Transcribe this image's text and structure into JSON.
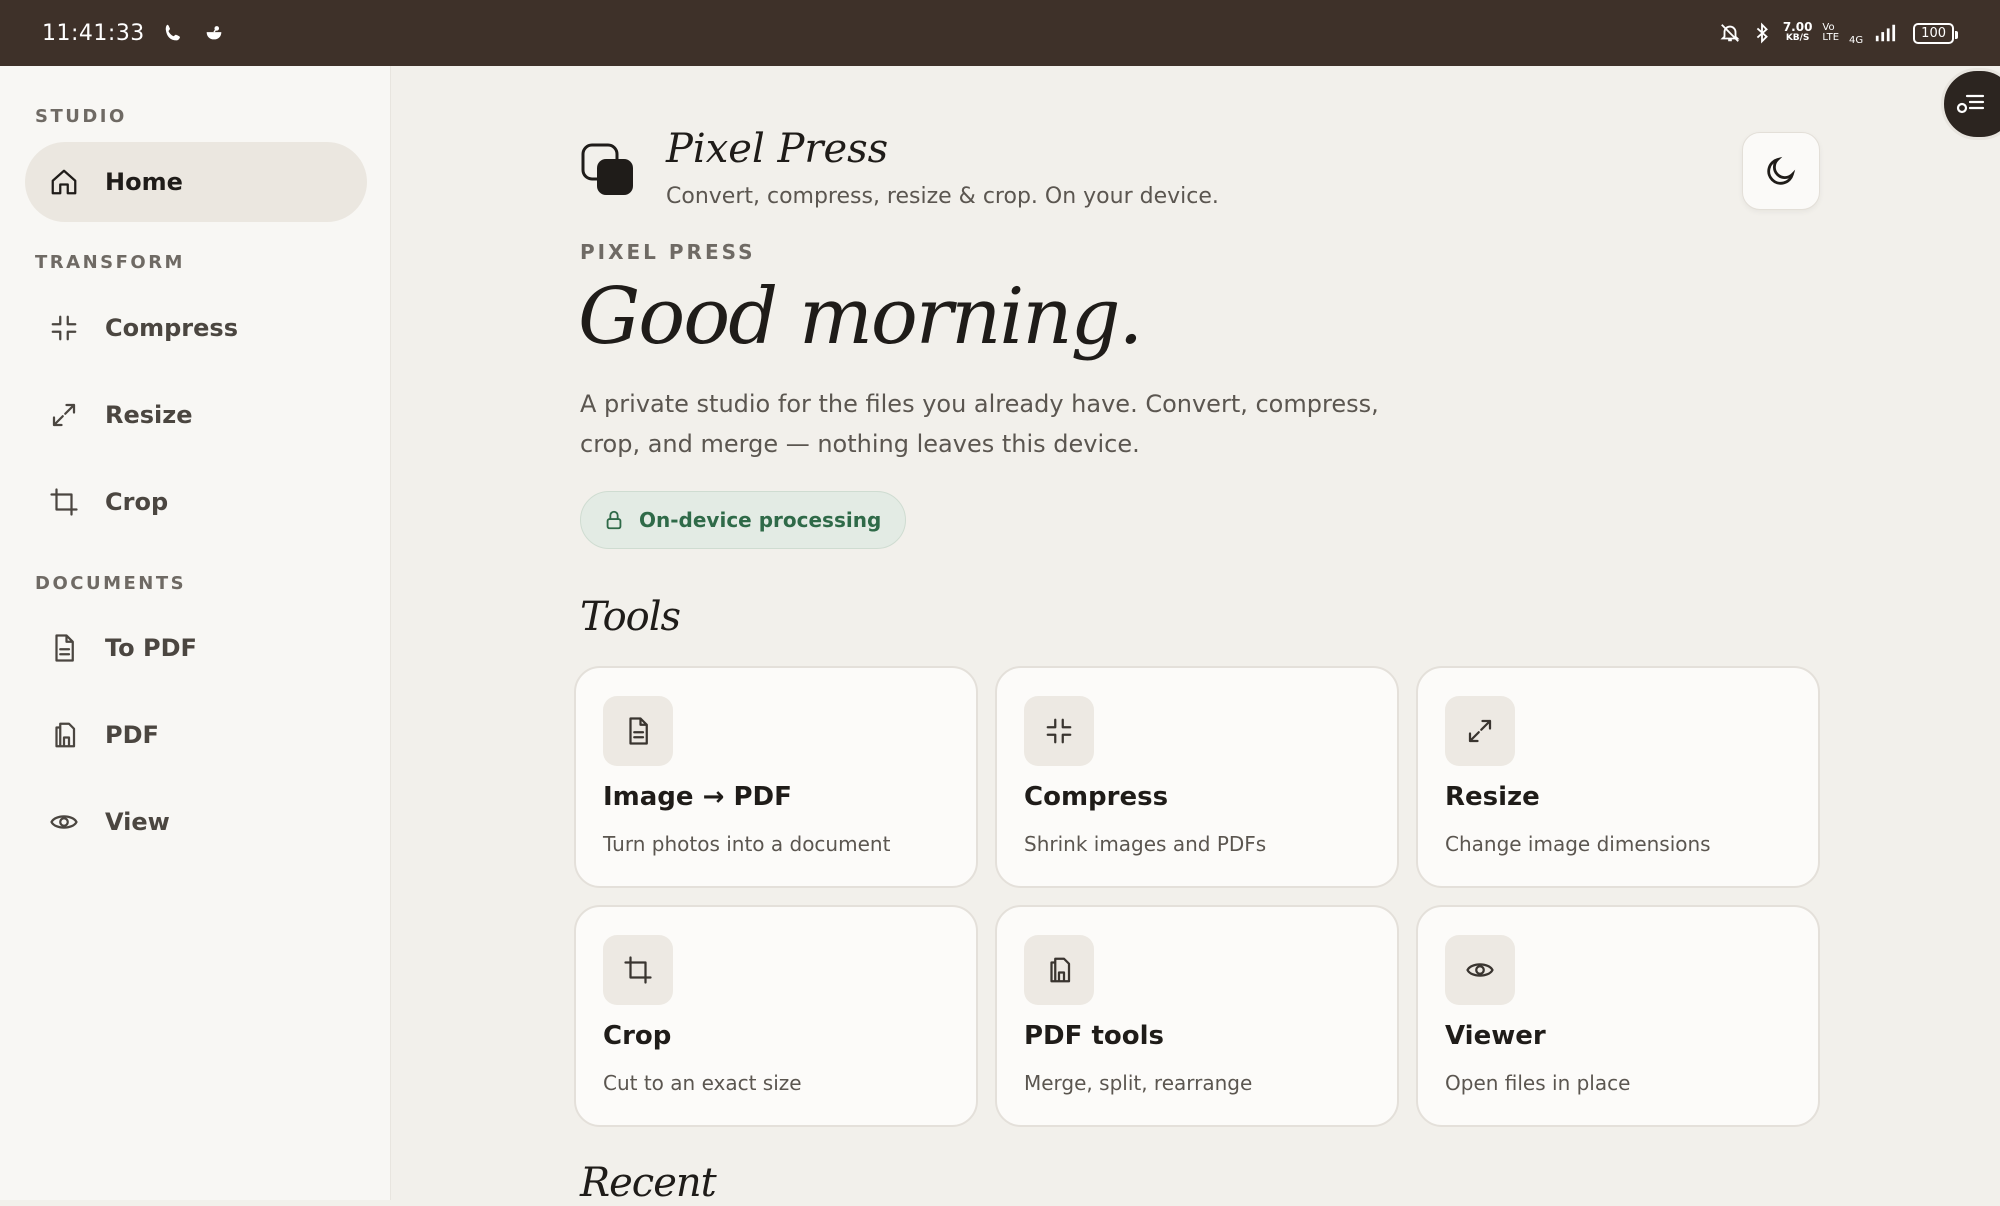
{
  "status_bar": {
    "time": "11:41:33",
    "speed_value": "7.00",
    "speed_unit": "KB/S",
    "volte_top": "Vo",
    "volte_bottom": "LTE",
    "network": "4G",
    "battery": "100"
  },
  "sidebar": {
    "sections": [
      {
        "label": "STUDIO"
      },
      {
        "label": "TRANSFORM"
      },
      {
        "label": "DOCUMENTS"
      }
    ],
    "items": [
      {
        "label": "Home",
        "icon": "home-icon",
        "active": true
      },
      {
        "label": "Compress",
        "icon": "compress-icon"
      },
      {
        "label": "Resize",
        "icon": "resize-icon"
      },
      {
        "label": "Crop",
        "icon": "crop-icon"
      },
      {
        "label": "To PDF",
        "icon": "document-icon"
      },
      {
        "label": "PDF",
        "icon": "pdf-stack-icon"
      },
      {
        "label": "View",
        "icon": "eye-icon"
      }
    ]
  },
  "header": {
    "title": "Pixel Press",
    "subtitle": "Convert, compress, resize & crop. On your device."
  },
  "hero": {
    "eyebrow": "PIXEL PRESS",
    "greeting": "Good morning.",
    "lede": "A private studio for the files you already have. Convert, compress, crop, and merge — nothing leaves this device.",
    "badge": "On-device processing"
  },
  "tools": {
    "heading": "Tools",
    "cards": [
      {
        "title": "Image → PDF",
        "desc": "Turn photos into a document",
        "icon": "document-icon"
      },
      {
        "title": "Compress",
        "desc": "Shrink images and PDFs",
        "icon": "compress-icon"
      },
      {
        "title": "Resize",
        "desc": "Change image dimensions",
        "icon": "resize-icon"
      },
      {
        "title": "Crop",
        "desc": "Cut to an exact size",
        "icon": "crop-icon"
      },
      {
        "title": "PDF tools",
        "desc": "Merge, split, rearrange",
        "icon": "pdf-stack-icon"
      },
      {
        "title": "Viewer",
        "desc": "Open files in place",
        "icon": "eye-icon"
      }
    ]
  },
  "recent": {
    "heading": "Recent"
  },
  "colors": {
    "status_bar": "#3e3129",
    "accent_green": "#2f6a48",
    "badge_bg": "#e3ebe4",
    "background": "#f2f0eb"
  }
}
